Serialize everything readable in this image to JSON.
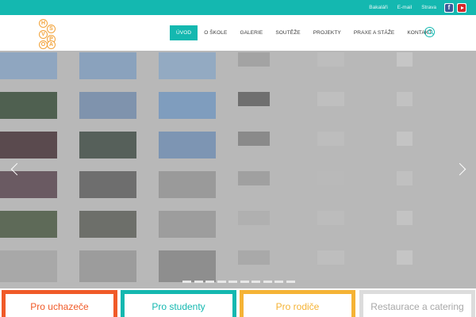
{
  "topbar": {
    "links": [
      "Bakaláři",
      "E-mail",
      "Strava"
    ],
    "social": [
      {
        "icon": "facebook-icon",
        "glyph": "f",
        "color": "#3b5998"
      },
      {
        "icon": "youtube-icon",
        "color": "#d6262a"
      }
    ],
    "background": "#14b8b0"
  },
  "logo": {
    "letters": [
      "H",
      "Š",
      "V",
      "P",
      "O",
      "A"
    ],
    "color": "#f2a33a"
  },
  "nav": {
    "items": [
      "ÚVOD",
      "O ŠKOLE",
      "GALERIE",
      "SOUTĚŽE",
      "PROJEKTY",
      "PRAXE A STÁŽE",
      "KONTAKT"
    ],
    "active": "ÚVOD",
    "accent": "#14b8b0",
    "search_icon": "search-icon"
  },
  "slider": {
    "prev_icon": "chevron-left-icon",
    "next_icon": "chevron-right-icon",
    "slide_count": 10,
    "active_slide": 1
  },
  "cards": [
    {
      "label": "Pro uchazeče",
      "color": "#f05a28"
    },
    {
      "label": "Pro studenty",
      "color": "#14b8b0"
    },
    {
      "label": "Pro rodiče",
      "color": "#f5b335"
    },
    {
      "label": "Restaurace a catering",
      "color": "#dcdcdc"
    }
  ]
}
